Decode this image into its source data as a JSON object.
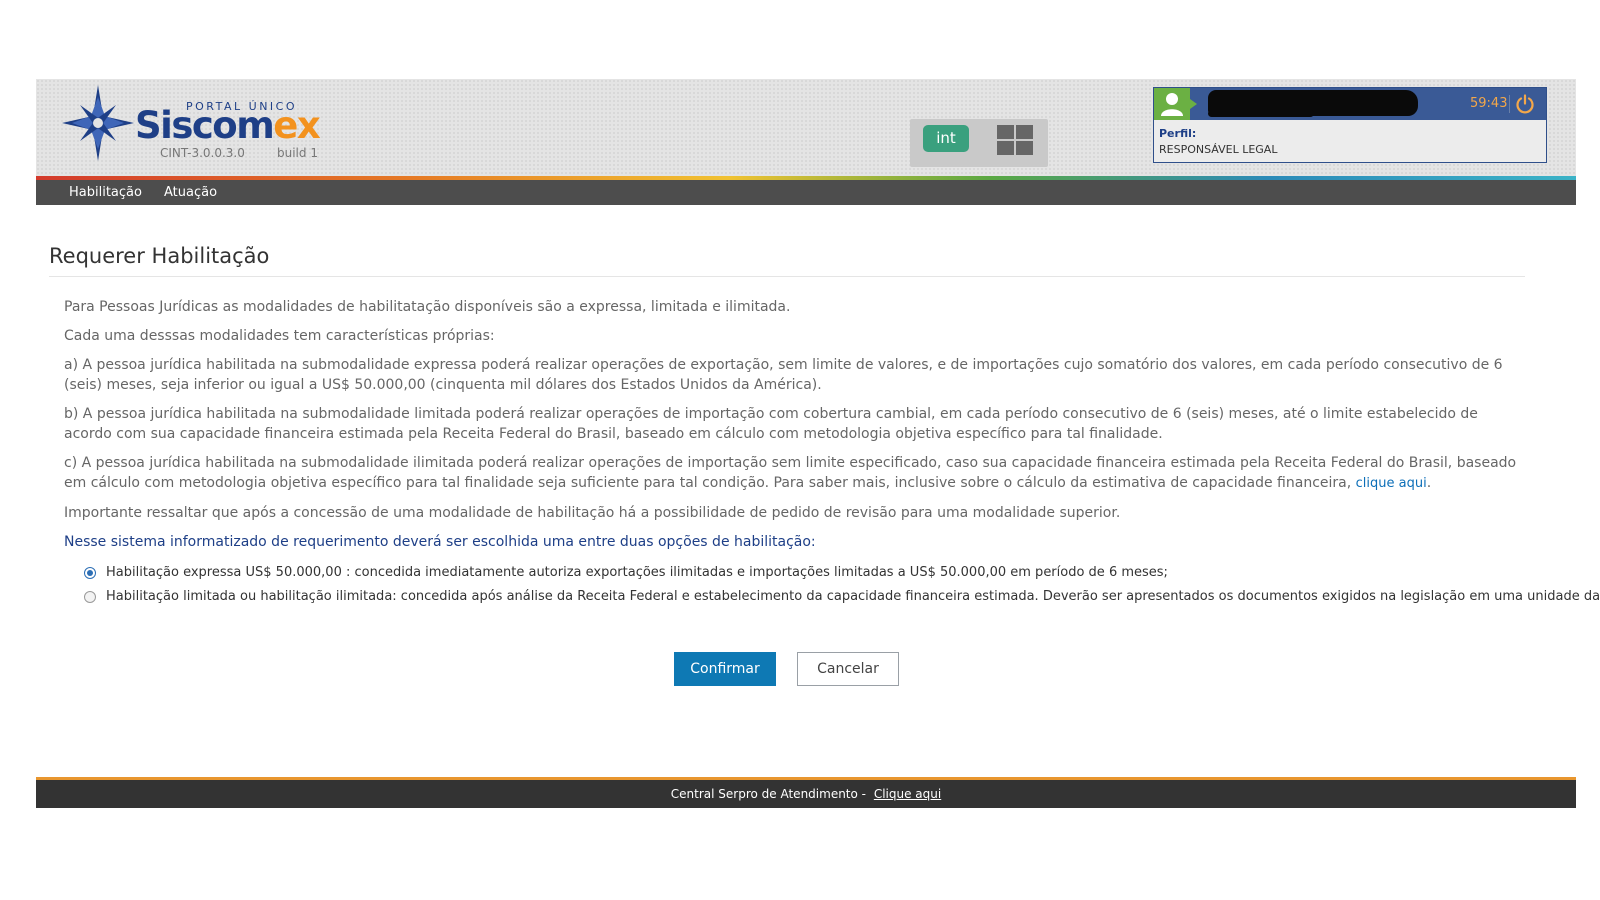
{
  "header": {
    "portal_label": "PORTAL ÚNICO",
    "brand_part1": "Siscom",
    "brand_part2": "ex",
    "version": "CINT-3.0.0.3.0",
    "build": "build 1",
    "environment_badge": "int",
    "user": {
      "name": "",
      "session_timer": "59:43",
      "profile_label": "Perfil:",
      "profile_value": "RESPONSÁVEL LEGAL"
    },
    "colors": {
      "brand_blue": "#1e3f87",
      "brand_orange": "#f3921e",
      "env_green": "#3aa07e",
      "user_bar": "#3a5a96"
    }
  },
  "nav": {
    "items": [
      {
        "label": "Habilitação"
      },
      {
        "label": "Atuação"
      }
    ]
  },
  "main": {
    "title": "Requerer Habilitação",
    "paragraphs": [
      "Para Pessoas Jurídicas as modalidades de habilitatação disponíveis são a expressa, limitada e ilimitada.",
      "Cada uma desssas modalidades tem características próprias:",
      "a) A pessoa jurídica habilitada na submodalidade expressa poderá realizar operações de exportação, sem limite de valores, e de importações cujo somatório dos valores, em cada período consecutivo de 6 (seis) meses, seja inferior ou igual a US$ 50.000,00 (cinquenta mil dólares dos Estados Unidos da América).",
      "b) A pessoa jurídica habilitada na submodalidade limitada poderá realizar operações de importação com cobertura cambial, em cada período consecutivo de 6 (seis) meses, até o limite estabelecido de acordo com sua capacidade financeira estimada pela Receita Federal do Brasil, baseado em cálculo com metodologia objetiva específico para tal finalidade.",
      "c) A pessoa jurídica habilitada na submodalidade ilimitada poderá realizar operações de importação sem limite especificado, caso sua capacidade financeira estimada pela Receita Federal do Brasil, baseado em cálculo com metodologia objetiva específico para tal finalidade seja suficiente para tal condição. Para saber mais, inclusive sobre o cálculo da estimativa de capacidade financeira,",
      "Importante ressaltar que após a concessão de uma modalidade de habilitação há a possibilidade de pedido de revisão para uma modalidade superior."
    ],
    "link_text": "clique aqui",
    "link_suffix": ".",
    "question": "Nesse sistema informatizado de requerimento deverá ser escolhida uma entre duas opções de habilitação:",
    "options": [
      {
        "label": "Habilitação expressa US$ 50.000,00 : concedida imediatamente autoriza exportações ilimitadas e importações limitadas a US$ 50.000,00 em período de 6 meses;",
        "selected": true
      },
      {
        "label": "Habilitação limitada ou habilitação ilimitada: concedida após análise da Receita Federal e estabelecimento da capacidade financeira estimada. Deverão ser apresentados os documentos exigidos na legislação em uma unidade da RFB.",
        "selected": false
      }
    ],
    "confirm_label": "Confirmar",
    "cancel_label": "Cancelar"
  },
  "footer": {
    "text": "Central Serpro de Atendimento -",
    "link_text": "Clique aqui"
  }
}
